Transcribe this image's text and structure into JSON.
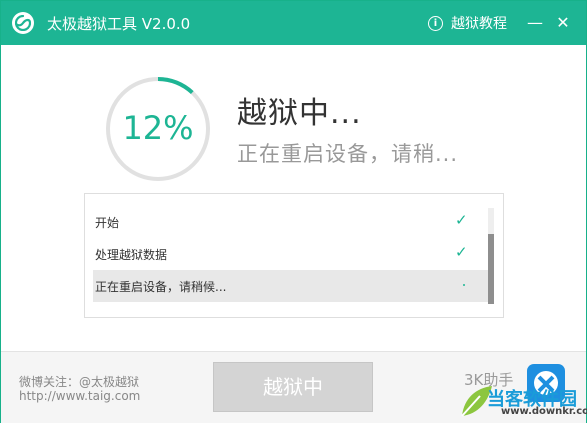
{
  "titlebar": {
    "app_title": "太极越狱工具 V2.0.0",
    "help_label": "越狱教程",
    "help_icon": "i",
    "minimize_label": "—",
    "close_label": "✕"
  },
  "progress": {
    "percent_text": "12%",
    "value": 0.12,
    "color": "#1db594",
    "track_color": "#e1e1e1"
  },
  "status": {
    "title": "越狱中...",
    "subtitle": "正在重启设备，请稍..."
  },
  "log": {
    "rows": [
      {
        "text": "开始",
        "state": "done",
        "mark": "✓"
      },
      {
        "text": "处理越狱数据",
        "state": "done",
        "mark": "✓"
      },
      {
        "text": "正在重启设备，请稍候...",
        "state": "in-progress",
        "mark": ""
      }
    ]
  },
  "footer": {
    "weibo": "微博关注：@太极越狱",
    "site": "http://www.taig.com",
    "main_button": "越狱中",
    "helper_text": "3K助手",
    "watermark_text": "当客软件园",
    "watermark_url": "www.downkr.com"
  },
  "colors": {
    "accent": "#1db594",
    "disabled_button": "#d4d4d4"
  }
}
